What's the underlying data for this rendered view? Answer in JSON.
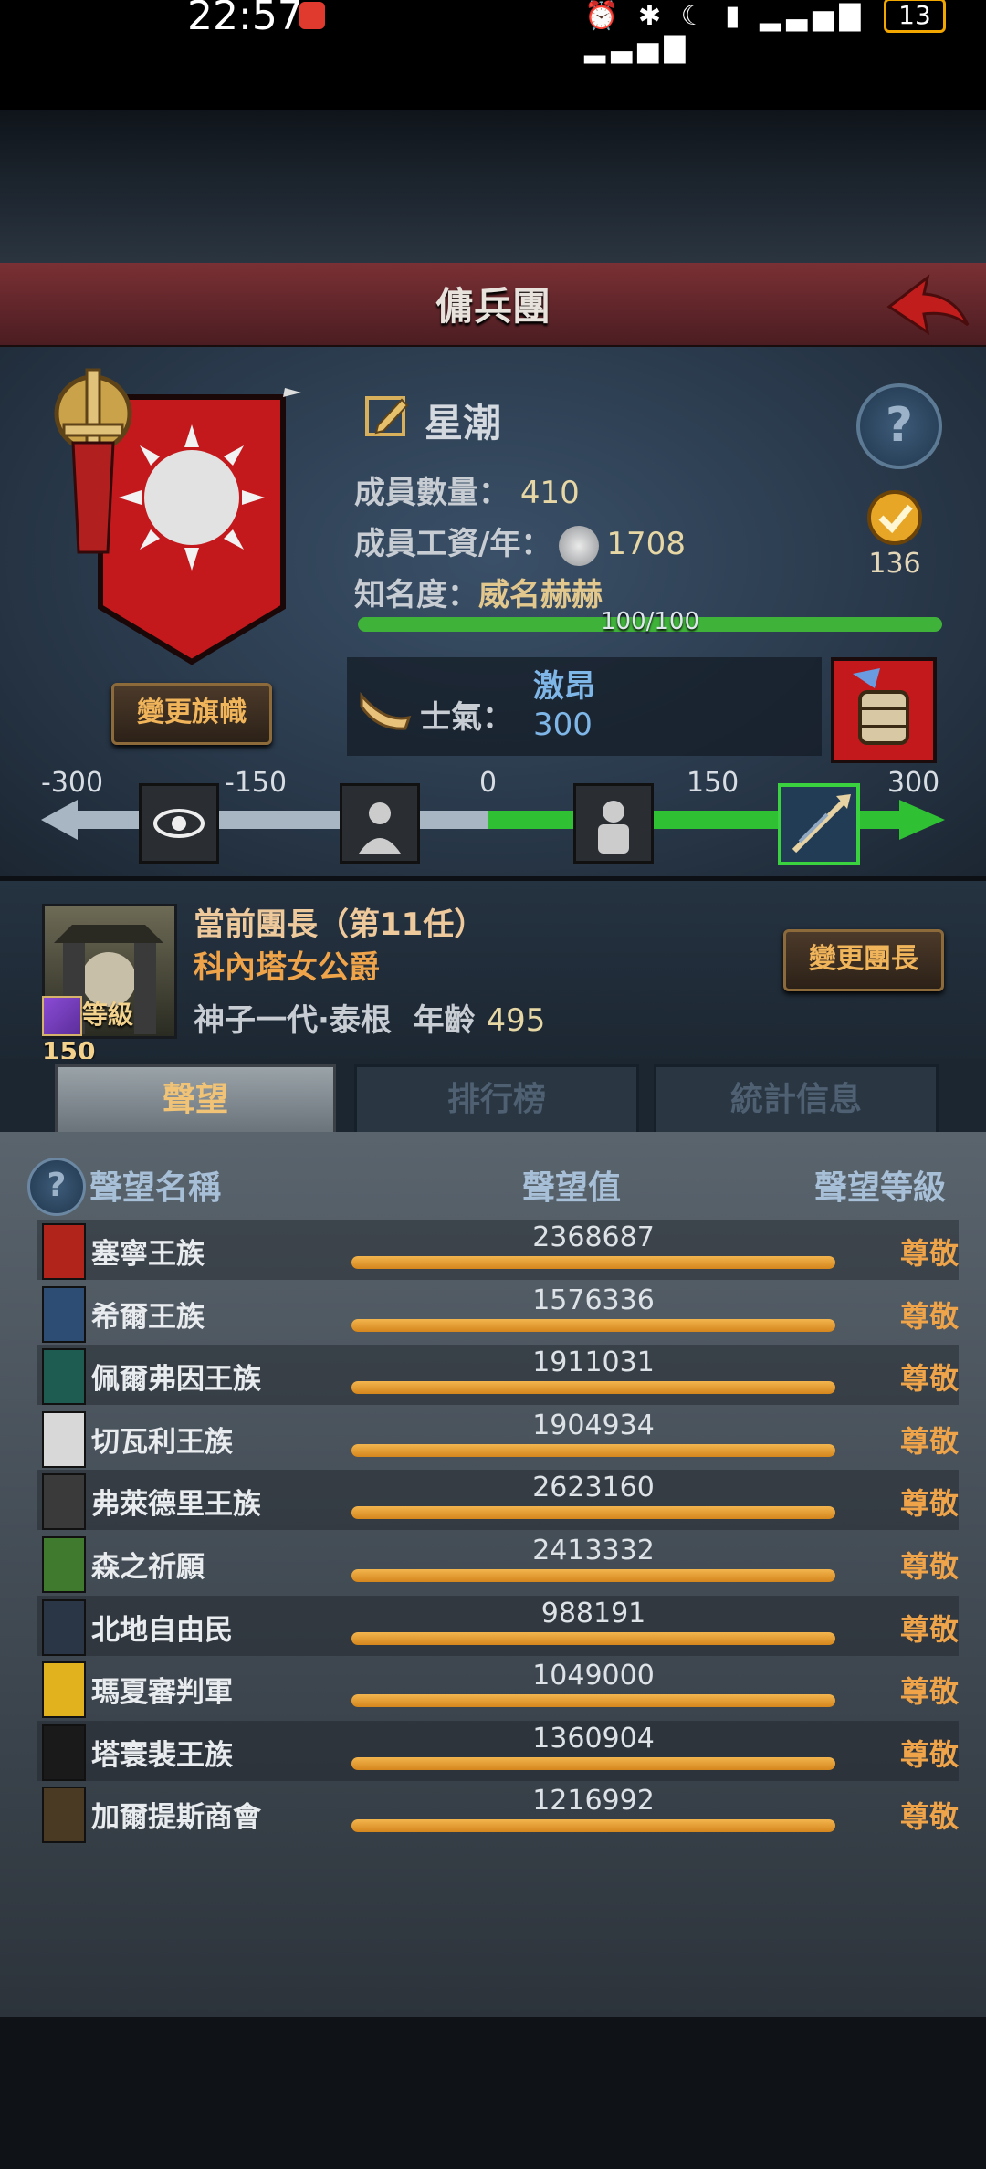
{
  "status_bar": {
    "time": "22:57",
    "battery": "13"
  },
  "header": {
    "title": "傭兵團"
  },
  "guild": {
    "name": "星潮",
    "members_label": "成員數量：",
    "members_value": "410",
    "salary_label": "成員工資/年：",
    "salary_value": "1708",
    "fame_label": "知名度：",
    "fame_value": "威名赫赫",
    "fame_progress_text": "100/100",
    "fame_progress_fraction": 1.0,
    "change_banner_label": "變更旗幟",
    "achievement_count": "136"
  },
  "morale": {
    "label": "士氣：",
    "state": "激昂",
    "value": "300",
    "scale_ticks": [
      "-300",
      "-150",
      "0",
      "150",
      "300"
    ]
  },
  "leader": {
    "title": "當前團長（第11任）",
    "name": "科內塔女公爵",
    "origin": "神子一代·泰根",
    "age_label": "年齡",
    "age_value": "495",
    "level_label": "等級150",
    "change_leader_label": "變更團長"
  },
  "tabs": [
    "聲望",
    "排行榜",
    "統計信息"
  ],
  "reputation": {
    "columns": {
      "name": "聲望名稱",
      "value": "聲望值",
      "level": "聲望等級"
    },
    "rows": [
      {
        "name": "塞寧王族",
        "value": "2368687",
        "level": "尊敬",
        "color": "#b0241c"
      },
      {
        "name": "希爾王族",
        "value": "1576336",
        "level": "尊敬",
        "color": "#2d4d74"
      },
      {
        "name": "佩爾弗因王族",
        "value": "1911031",
        "level": "尊敬",
        "color": "#1e5c52"
      },
      {
        "name": "切瓦利王族",
        "value": "1904934",
        "level": "尊敬",
        "color": "#d8d8d8"
      },
      {
        "name": "弗萊德里王族",
        "value": "2623160",
        "level": "尊敬",
        "color": "#3a3a3a"
      },
      {
        "name": "森之祈願",
        "value": "2413332",
        "level": "尊敬",
        "color": "#3f7a2e"
      },
      {
        "name": "北地自由民",
        "value": "988191",
        "level": "尊敬",
        "color": "#2a3645"
      },
      {
        "name": "瑪夏審判軍",
        "value": "1049000",
        "level": "尊敬",
        "color": "#e2b21e"
      },
      {
        "name": "塔寰裴王族",
        "value": "1360904",
        "level": "尊敬",
        "color": "#1a1a1a"
      },
      {
        "name": "加爾提斯商會",
        "value": "1216992",
        "level": "尊敬",
        "color": "#4a3a24"
      }
    ],
    "bar_fill_fraction": 1.0
  }
}
